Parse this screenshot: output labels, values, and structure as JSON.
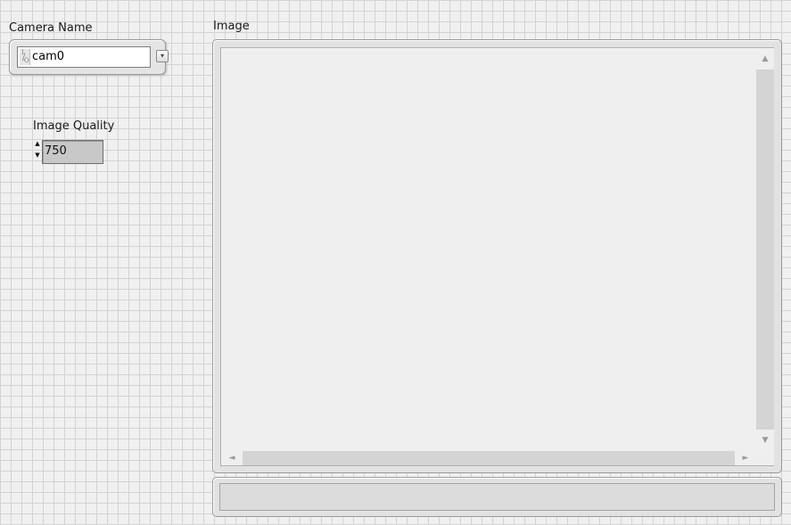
{
  "camera": {
    "label": "Camera Name",
    "value": "cam0",
    "io_tag_top": "I",
    "io_tag_bottom": "O",
    "io_tag_slash": "/"
  },
  "quality": {
    "label": "Image Quality",
    "value": "750"
  },
  "image": {
    "label": "Image"
  },
  "status": {
    "text": ""
  },
  "icons": {
    "dropdown": "▾",
    "inc": "▲",
    "dec": "▼",
    "scroll_up": "▲",
    "scroll_down": "▼",
    "scroll_left": "◄",
    "scroll_right": "►"
  },
  "colors": {
    "grid_background": "#f0f0f0",
    "grid_lines": "#d3d3d3",
    "numeric_field": "#c8c8c8"
  }
}
